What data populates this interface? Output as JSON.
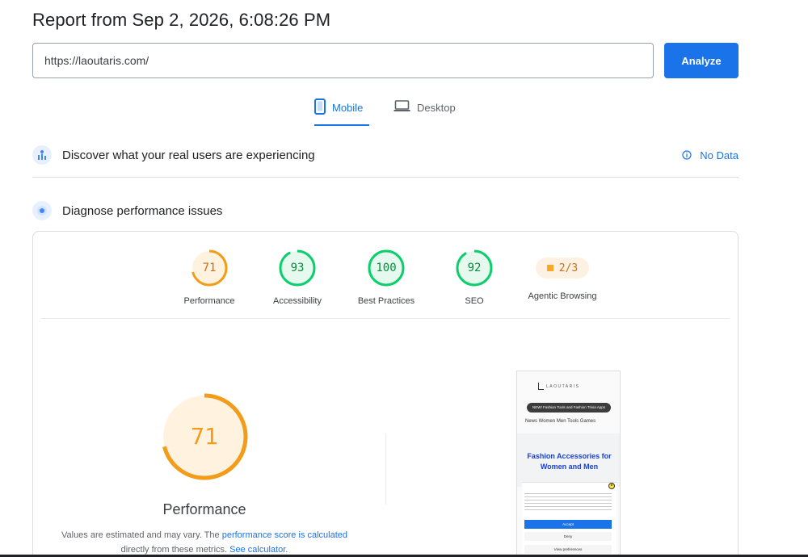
{
  "report": {
    "title": "Report from Sep 2, 2026, 6:08:26 PM"
  },
  "search": {
    "url_value": "https://laoutaris.com/",
    "analyze_label": "Analyze"
  },
  "tabs": [
    {
      "label": "Mobile",
      "icon": "smartphone-icon",
      "active": true
    },
    {
      "label": "Desktop",
      "icon": "laptop-icon",
      "active": false
    }
  ],
  "field_data": {
    "title": "Discover what your real users are experiencing",
    "status": "No Data"
  },
  "lab_data": {
    "title": "Diagnose performance issues"
  },
  "scores": [
    {
      "value": "71",
      "label": "Performance",
      "color": "#f29c1a",
      "fill": "#fff3e0",
      "fraction": 0.71
    },
    {
      "value": "93",
      "label": "Accessibility",
      "color": "#0cce6b",
      "fill": "#e6f9ee",
      "fraction": 0.93
    },
    {
      "value": "100",
      "label": "Best Practices",
      "color": "#0cce6b",
      "fill": "#e6f9ee",
      "fraction": 1.0
    },
    {
      "value": "92",
      "label": "SEO",
      "color": "#0cce6b",
      "fill": "#e6f9ee",
      "fraction": 0.92
    }
  ],
  "agentic": {
    "value": "2/3",
    "label": "Agentic Browsing"
  },
  "main_score": {
    "value": "71",
    "label": "Performance",
    "fraction": 0.71,
    "color": "#f29c1a"
  },
  "note": {
    "text1": "Values are estimated and may vary. The ",
    "link1": "performance score is calculated",
    "text2": " directly from these metrics. ",
    "link2": "See calculator."
  },
  "screenshot": {
    "banner": "NEW! Fashion Tools and Fashion Trivia Apps",
    "nav": "News  Women  Men  Tools  Games",
    "hero": "Fashion Accessories for Women and Men",
    "accept": "Accept",
    "deny": "Deny",
    "prefs": "View preferences"
  }
}
